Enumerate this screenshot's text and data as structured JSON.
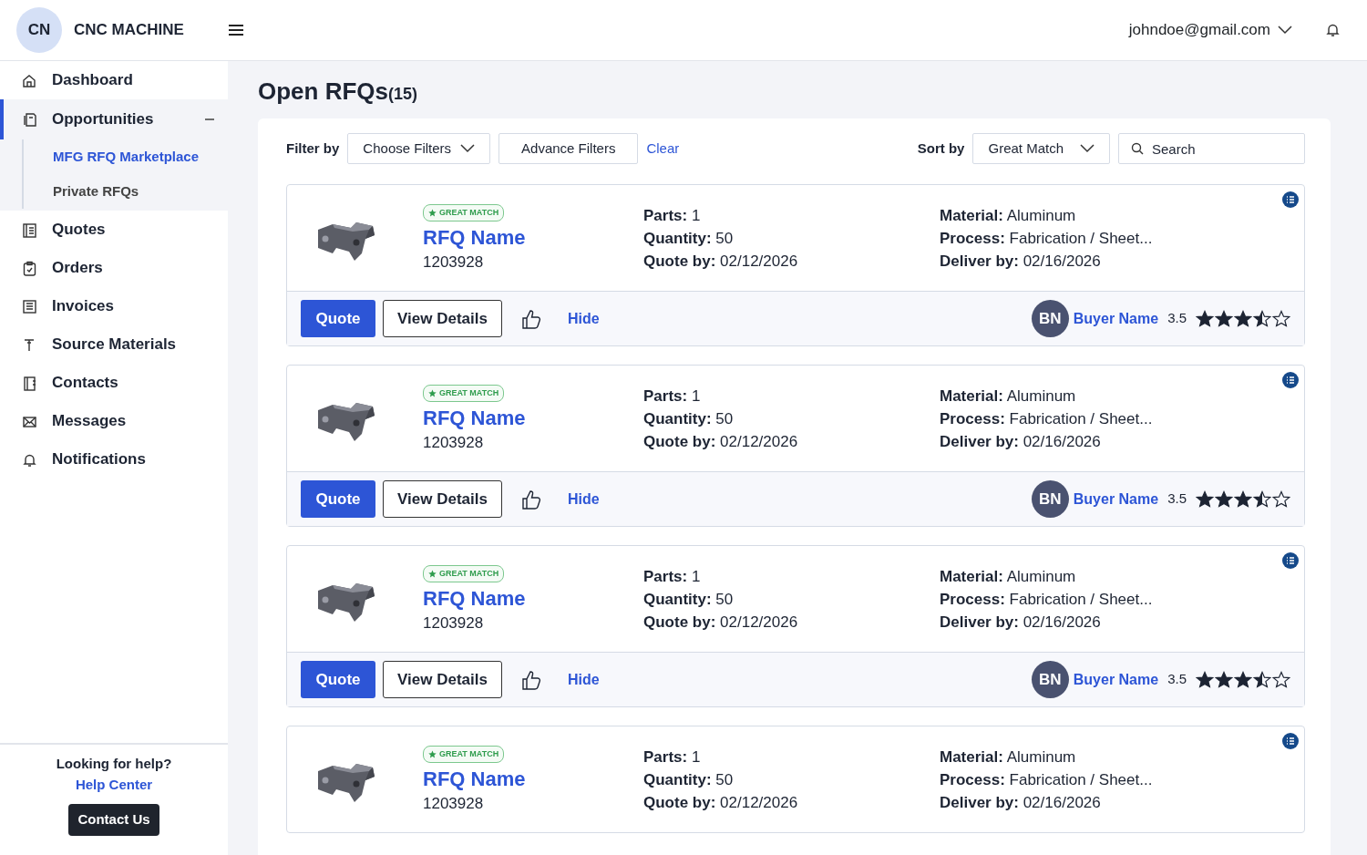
{
  "header": {
    "logo_initials": "CN",
    "app_name": "CNC MACHINE",
    "user_email": "johndoe@gmail.com"
  },
  "sidebar": {
    "items": [
      {
        "label": "Dashboard",
        "selected": false
      },
      {
        "label": "Opportunities",
        "selected": true,
        "expanded": true,
        "children": [
          {
            "label": "MFG RFQ Marketplace",
            "selected": true
          },
          {
            "label": "Private RFQs",
            "selected": false
          }
        ]
      },
      {
        "label": "Quotes",
        "selected": false
      },
      {
        "label": "Orders",
        "selected": false
      },
      {
        "label": "Invoices",
        "selected": false
      },
      {
        "label": "Source Materials",
        "selected": false
      },
      {
        "label": "Contacts",
        "selected": false
      },
      {
        "label": "Messages",
        "selected": false
      },
      {
        "label": "Notifications",
        "selected": false
      }
    ],
    "help": {
      "prompt": "Looking for help?",
      "link": "Help Center",
      "button": "Contact Us"
    }
  },
  "page": {
    "title": "Open RFQs",
    "count": "(15)"
  },
  "toolbar": {
    "filter_label": "Filter by",
    "filter_dropdown": "Choose Filters",
    "advance_button": "Advance Filters",
    "clear_link": "Clear",
    "sort_label": "Sort by",
    "sort_dropdown": "Great Match",
    "search": {
      "placeholder": "Search"
    }
  },
  "rfqs": [
    {
      "badge": "GREAT MATCH",
      "name": "RFQ Name",
      "number": "1203928",
      "details": [
        {
          "label": "Parts:",
          "value": "1"
        },
        {
          "label": "Quantity:",
          "value": "50"
        },
        {
          "label": "Quote by:",
          "value": "02/12/2026"
        }
      ],
      "specs": [
        {
          "label": "Material:",
          "value": "Aluminum"
        },
        {
          "label": "Process:",
          "value": "Fabrication / Sheet..."
        },
        {
          "label": "Deliver by:",
          "value": "02/16/2026"
        }
      ],
      "footer": {
        "quote_button": "Quote",
        "details_button": "View Details",
        "hide_link": "Hide",
        "buyer_initials": "BN",
        "buyer_name": "Buyer Name",
        "rating": "3.5",
        "stars": 3.5
      }
    },
    {
      "badge": "GREAT MATCH",
      "name": "RFQ Name",
      "number": "1203928",
      "details": [
        {
          "label": "Parts:",
          "value": "1"
        },
        {
          "label": "Quantity:",
          "value": "50"
        },
        {
          "label": "Quote by:",
          "value": "02/12/2026"
        }
      ],
      "specs": [
        {
          "label": "Material:",
          "value": "Aluminum"
        },
        {
          "label": "Process:",
          "value": "Fabrication / Sheet..."
        },
        {
          "label": "Deliver by:",
          "value": "02/16/2026"
        }
      ],
      "footer": {
        "quote_button": "Quote",
        "details_button": "View Details",
        "hide_link": "Hide",
        "buyer_initials": "BN",
        "buyer_name": "Buyer Name",
        "rating": "3.5",
        "stars": 3.5
      }
    },
    {
      "badge": "GREAT MATCH",
      "name": "RFQ Name",
      "number": "1203928",
      "details": [
        {
          "label": "Parts:",
          "value": "1"
        },
        {
          "label": "Quantity:",
          "value": "50"
        },
        {
          "label": "Quote by:",
          "value": "02/12/2026"
        }
      ],
      "specs": [
        {
          "label": "Material:",
          "value": "Aluminum"
        },
        {
          "label": "Process:",
          "value": "Fabrication / Sheet..."
        },
        {
          "label": "Deliver by:",
          "value": "02/16/2026"
        }
      ],
      "footer": {
        "quote_button": "Quote",
        "details_button": "View Details",
        "hide_link": "Hide",
        "buyer_initials": "BN",
        "buyer_name": "Buyer Name",
        "rating": "3.5",
        "stars": 3.5
      }
    },
    {
      "badge": "GREAT MATCH",
      "name": "RFQ Name",
      "number": "1203928",
      "details": [
        {
          "label": "Parts:",
          "value": "1"
        },
        {
          "label": "Quantity:",
          "value": "50"
        },
        {
          "label": "Quote by:",
          "value": "02/12/2026"
        }
      ],
      "specs": [
        {
          "label": "Material:",
          "value": "Aluminum"
        },
        {
          "label": "Process:",
          "value": "Fabrication / Sheet..."
        },
        {
          "label": "Deliver by:",
          "value": "02/16/2026"
        }
      ]
    }
  ]
}
